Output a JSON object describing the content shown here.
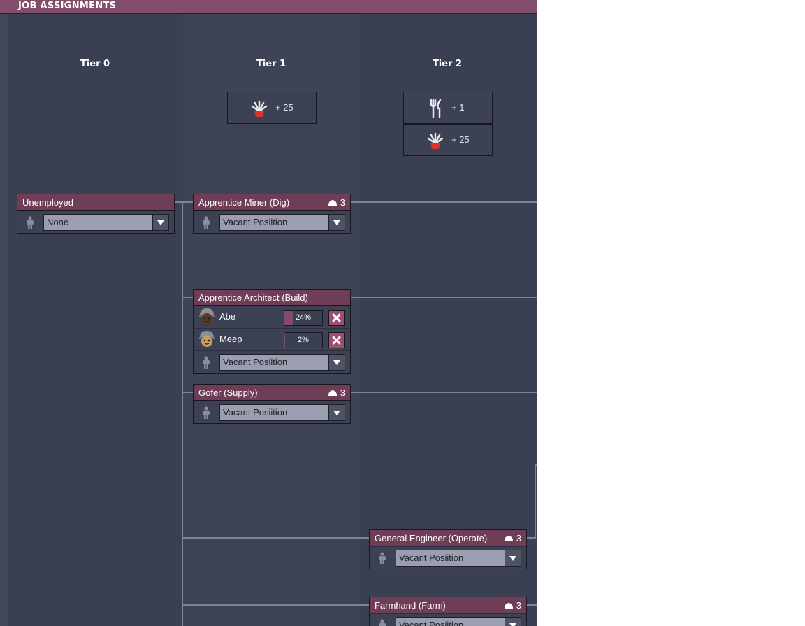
{
  "panel": {
    "title": "JOB ASSIGNMENTS"
  },
  "tiers": [
    "Tier 0",
    "Tier 1",
    "Tier 2"
  ],
  "tier1_bonuses": [
    {
      "icon": "decor-plant-icon",
      "label": "+ 25"
    }
  ],
  "tier2_bonuses": [
    {
      "icon": "fork-knife-icon",
      "label": "+ 1"
    },
    {
      "icon": "decor-plant-icon",
      "label": "+ 25"
    }
  ],
  "jobs": {
    "unemployed": {
      "title": "Unemployed",
      "dropdown": "None"
    },
    "miner": {
      "title": "Apprentice Miner (Dig)",
      "cap": "3",
      "dropdown": "Vacant Posiition"
    },
    "architect": {
      "title": "Apprentice Architect (Build)",
      "workers": [
        {
          "name": "Abe",
          "progress_label": "24%",
          "progress": 0.24
        },
        {
          "name": "Meep",
          "progress_label": "2%",
          "progress": 0.02
        }
      ],
      "dropdown": "Vacant Posiition"
    },
    "gofer": {
      "title": "Gofer (Supply)",
      "cap": "3",
      "dropdown": "Vacant Posiition"
    },
    "engineer": {
      "title": "General Engineer (Operate)",
      "cap": "3",
      "dropdown": "Vacant Posiition"
    },
    "farmhand": {
      "title": "Farmhand (Farm)",
      "cap": "3",
      "dropdown": "Vacant Posiition"
    }
  },
  "colors": {
    "title_bar": "#824d6a",
    "job_header": "#6f3d55",
    "panel_bg": "#3b3f52",
    "remove_button": "#a04e6f"
  }
}
